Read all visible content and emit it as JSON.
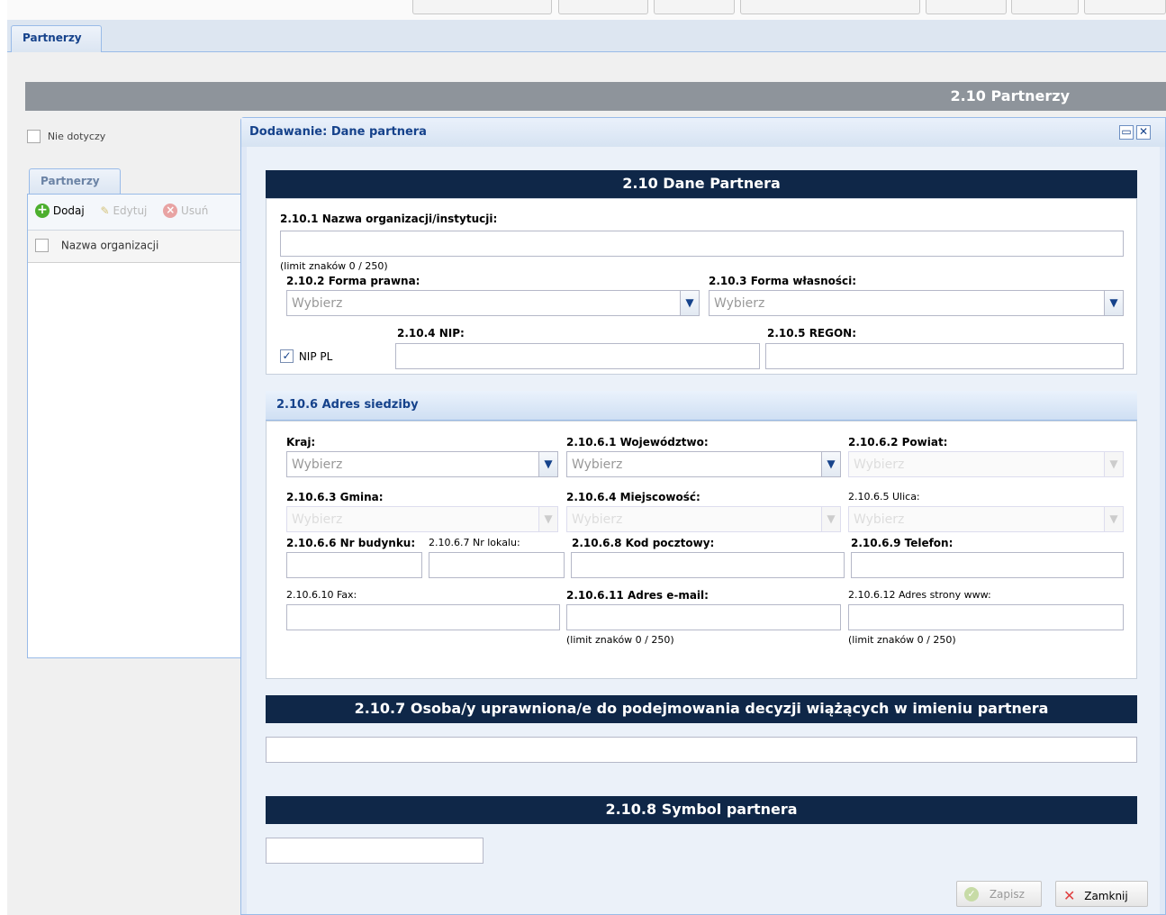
{
  "tabs": {
    "main": "Partnerzy",
    "inner": "Partnerzy"
  },
  "header": {
    "title": "2.10 Partnerzy"
  },
  "left": {
    "not_applicable": "Nie dotyczy",
    "grid": {
      "add": "Dodaj",
      "edit": "Edytuj",
      "delete": "Usuń",
      "column_name": "Nazwa organizacji"
    }
  },
  "dialog": {
    "title": "Dodawanie: Dane partnera",
    "section_title": "2.10 Dane Partnera",
    "org_name_label": "2.10.1 Nazwa organizacji/instytucji:",
    "org_name_limit": "(limit znaków 0 / 250)",
    "legal_form_label": "2.10.2 Forma prawna:",
    "ownership_label": "2.10.3 Forma własności:",
    "select_placeholder": "Wybierz",
    "nip_pl": "NIP PL",
    "nip_label": "2.10.4 NIP:",
    "regon_label": "2.10.5 REGON:",
    "address": {
      "title": "2.10.6 Adres siedziby",
      "country": "Kraj:",
      "voivodeship": "2.10.6.1 Województwo:",
      "county": "2.10.6.2 Powiat:",
      "commune": "2.10.6.3 Gmina:",
      "locality": "2.10.6.4 Miejscowość:",
      "street": "2.10.6.5 Ulica:",
      "building_no": "2.10.6.6 Nr budynku:",
      "apartment_no": "2.10.6.7 Nr lokalu:",
      "postal_code": "2.10.6.8 Kod pocztowy:",
      "phone": "2.10.6.9 Telefon:",
      "fax": "2.10.6.10 Fax:",
      "email": "2.10.6.11 Adres e-mail:",
      "www": "2.10.6.12 Adres strony www:",
      "email_limit": "(limit znaków 0 / 250)",
      "www_limit": "(limit znaków 0 / 250)"
    },
    "authorized_title": "2.10.7 Osoba/y uprawniona/e do podejmowania decyzji wiążących w imieniu partnera",
    "symbol_title": "2.10.8 Symbol partnera",
    "save": "Zapisz",
    "close": "Zamknij"
  }
}
